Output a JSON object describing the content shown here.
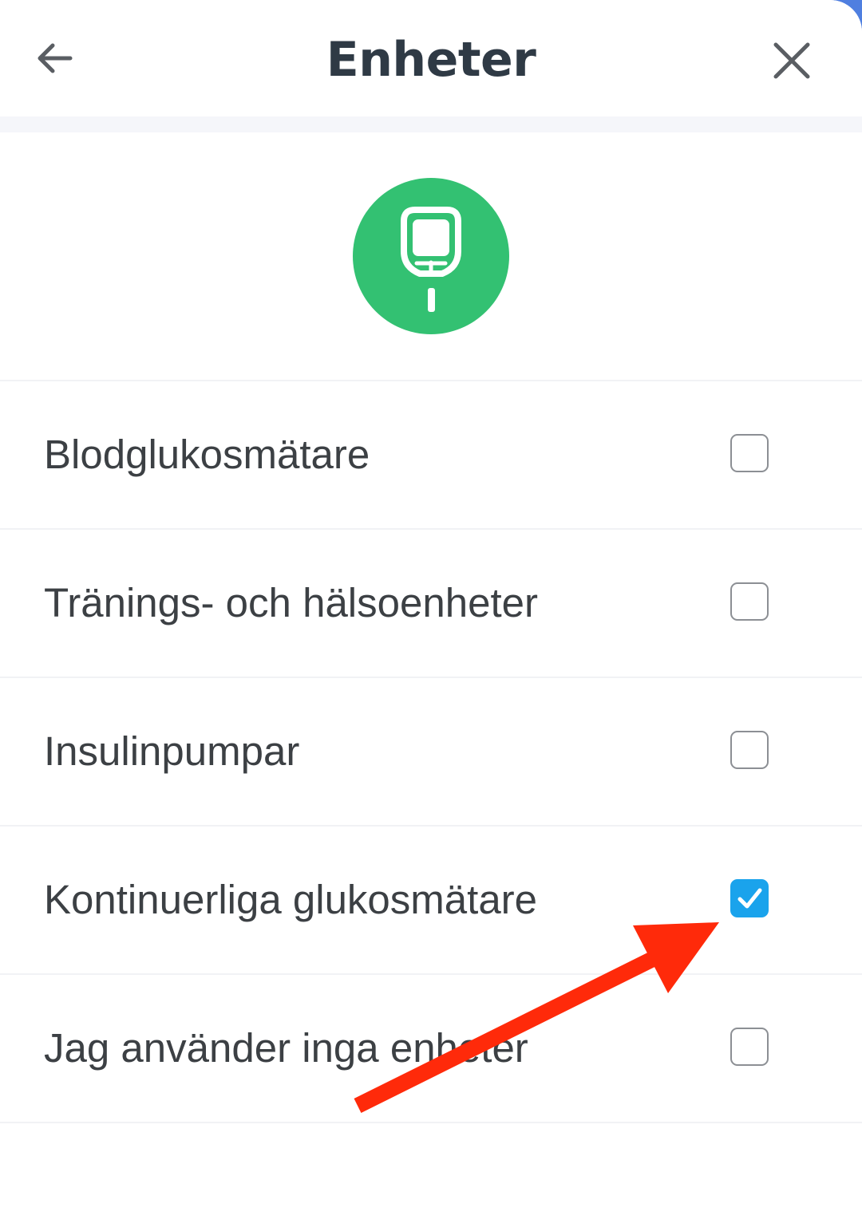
{
  "header": {
    "title": "Enheter",
    "back_icon": "arrow-left-icon",
    "close_icon": "close-icon"
  },
  "hero": {
    "icon": "glucose-meter-icon",
    "icon_color": "#33c172"
  },
  "devices": [
    {
      "label": "Blodglukosmätare",
      "checked": false
    },
    {
      "label": "Tränings- och hälsoenheter",
      "checked": false
    },
    {
      "label": "Insulinpumpar",
      "checked": false
    },
    {
      "label": "Kontinuerliga glukosmätare",
      "checked": true
    },
    {
      "label": "Jag använder inga enheter",
      "checked": false
    }
  ],
  "colors": {
    "checkbox_checked": "#1aa3ec",
    "annotation_arrow": "#ff2a0a",
    "title_text": "#2f3a45"
  },
  "annotation": {
    "icon": "red-arrow-annotation",
    "points_to": "Kontinuerliga glukosmätare"
  }
}
